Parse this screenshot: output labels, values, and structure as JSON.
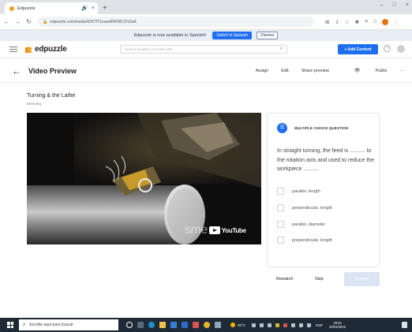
{
  "browser": {
    "tab_title": "Edpuzzle",
    "tab_icons": {
      "media": "🔊",
      "close": "×"
    },
    "new_tab": "+",
    "window_controls": {
      "minimize": "–",
      "maximize": "□",
      "close": "×"
    },
    "nav_icons": {
      "back": "←",
      "forward": "→",
      "reload": "↻"
    },
    "url": "edpuzzle.com/media/6267f71caee89428137c5a6"
  },
  "banner": {
    "message": "Edpuzzle is now available in Spanish!",
    "switch_label": "Switch to Spanish",
    "dismiss_label": "Dismiss"
  },
  "app": {
    "logo": "edpuzzle",
    "search_placeholder": "Search in public YouTube URL",
    "add_content_label": "+ Add Content",
    "help_icon": "?"
  },
  "preview": {
    "title": "Video Preview",
    "actions": {
      "assign": "Assign",
      "edit": "Edit",
      "share": "Share preview",
      "public": "Public",
      "more": "···"
    }
  },
  "video": {
    "title": "Turning & the Lathe",
    "author": "Irene Boj",
    "watermark": "sme",
    "youtube": "YouTube"
  },
  "question": {
    "type_label": "MULTIPLE CHOICE QUESTION",
    "text": "In straight turning, the feed is .......... to the rotation axis and used to reduce the workpiece ..........",
    "options": [
      "parallel, length",
      "perpendicular, length",
      "parallel, diameter",
      "prependicular, length"
    ],
    "rewatch": "Rewatch",
    "skip": "Skip",
    "submit": "Submit"
  },
  "taskbar": {
    "search_placeholder": "Escribe aquí para buscar",
    "weather": "20°C",
    "lang": "ESP",
    "time": "19:52",
    "date": "20/04/2022"
  },
  "colors": {
    "accent": "#1e6ff0",
    "submit_disabled": "#dbe4f3"
  }
}
